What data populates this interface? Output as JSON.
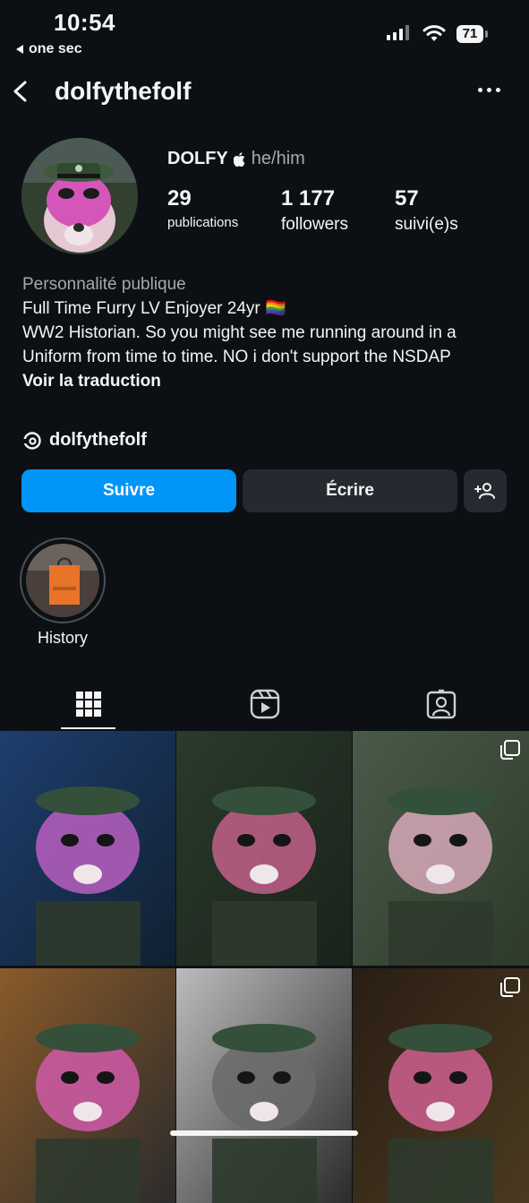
{
  "status_bar": {
    "time": "10:54",
    "back_app": "one sec",
    "battery": "71"
  },
  "header": {
    "username": "dolfythefolf"
  },
  "profile": {
    "display_name": "DOLFY",
    "pronouns": "he/him",
    "stats": [
      {
        "value": "29",
        "label": "publications"
      },
      {
        "value": "1 177",
        "label": "followers"
      },
      {
        "value": "57",
        "label": "suivi(e)s"
      }
    ]
  },
  "bio": {
    "category": "Personnalité publique",
    "lines": [
      "Full Time Furry LV Enjoyer 24yr 🏳️‍🌈",
      "WW2 Historian. So you might see me running around in a Uniform from time to time. NO i don't support the NSDAP"
    ],
    "translate_link": "Voir la traduction",
    "threads_handle": "dolfythefolf"
  },
  "actions": {
    "follow": "Suivre",
    "message": "Écrire"
  },
  "highlights": [
    {
      "label": "History"
    }
  ],
  "tabs": [
    {
      "icon": "grid-icon",
      "active": true
    },
    {
      "icon": "reels-icon",
      "active": false
    },
    {
      "icon": "tagged-icon",
      "active": false
    }
  ],
  "grid": [
    {
      "multi": false,
      "colors": [
        "#1e3e6e",
        "#b85fc0",
        "#102030"
      ]
    },
    {
      "multi": false,
      "colors": [
        "#2a3a2c",
        "#c2608a",
        "#1a221a"
      ]
    },
    {
      "multi": true,
      "colors": [
        "#4a5a48",
        "#d7a8b8",
        "#2d3a2a"
      ]
    },
    {
      "multi": false,
      "colors": [
        "#8a5a2a",
        "#d05aa8",
        "#2b2b2b"
      ]
    },
    {
      "multi": false,
      "colors": [
        "#bcbcbc",
        "#6a6a6a",
        "#2a2a2a"
      ]
    },
    {
      "multi": true,
      "colors": [
        "#2a1e14",
        "#d06090",
        "#4a3a20"
      ]
    }
  ]
}
